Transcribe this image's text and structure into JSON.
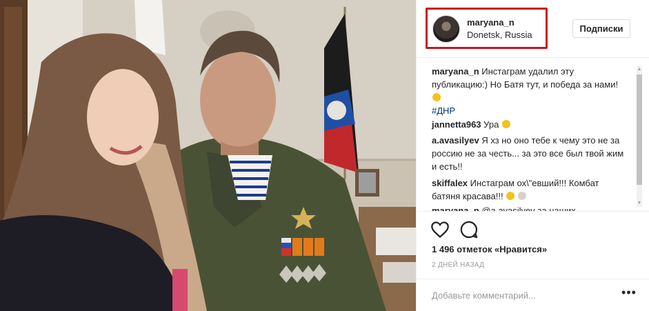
{
  "post": {
    "photo_label": "",
    "header": {
      "username": "maryana_n",
      "location": "Donetsk, Russia",
      "follow_label": "Подписки"
    },
    "comments": [
      {
        "author": "maryana_n",
        "text": "Инстаграм удалил эту публикацию:) Но Батя тут, и победа за нами!",
        "emoji": "smiling-face-with-sunglasses",
        "tag": "#ДНР"
      },
      {
        "author": "jannetta963",
        "text": "Ура",
        "emoji": "smiling-face"
      },
      {
        "author": "a.avasilyev",
        "text": "Я хз но оно тебе к чему это не за россию не за честь... за это все был твой жим и есть!!"
      },
      {
        "author": "skiffalex",
        "text": "Инстаграм ох\\\"евший!!! Комбат батяня красава!!!",
        "emoji": "smiling-face thumbs-up"
      },
      {
        "author": "maryana_n",
        "text": "@a.avasilyev за наших"
      }
    ],
    "actions": {
      "like_icon": "heart-icon",
      "comment_icon": "speech-bubble-icon",
      "likes_text": "1 496 отметок «Нравится»",
      "time_text": "2 ДНЕЙ НАЗАД"
    },
    "add_comment": {
      "placeholder": "Добавьте комментарий...",
      "more_label": "•••"
    },
    "colors": {
      "highlight_border": "#c8161d",
      "text": "#262626",
      "muted": "#999999",
      "link": "#003569"
    }
  }
}
